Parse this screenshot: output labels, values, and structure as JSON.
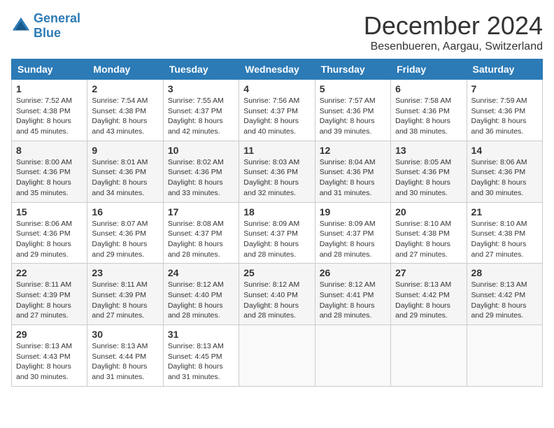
{
  "header": {
    "logo_line1": "General",
    "logo_line2": "Blue",
    "month": "December 2024",
    "location": "Besenbueren, Aargau, Switzerland"
  },
  "weekdays": [
    "Sunday",
    "Monday",
    "Tuesday",
    "Wednesday",
    "Thursday",
    "Friday",
    "Saturday"
  ],
  "weeks": [
    [
      {
        "day": "1",
        "sunrise": "7:52 AM",
        "sunset": "4:38 PM",
        "daylight": "8 hours and 45 minutes."
      },
      {
        "day": "2",
        "sunrise": "7:54 AM",
        "sunset": "4:38 PM",
        "daylight": "8 hours and 43 minutes."
      },
      {
        "day": "3",
        "sunrise": "7:55 AM",
        "sunset": "4:37 PM",
        "daylight": "8 hours and 42 minutes."
      },
      {
        "day": "4",
        "sunrise": "7:56 AM",
        "sunset": "4:37 PM",
        "daylight": "8 hours and 40 minutes."
      },
      {
        "day": "5",
        "sunrise": "7:57 AM",
        "sunset": "4:36 PM",
        "daylight": "8 hours and 39 minutes."
      },
      {
        "day": "6",
        "sunrise": "7:58 AM",
        "sunset": "4:36 PM",
        "daylight": "8 hours and 38 minutes."
      },
      {
        "day": "7",
        "sunrise": "7:59 AM",
        "sunset": "4:36 PM",
        "daylight": "8 hours and 36 minutes."
      }
    ],
    [
      {
        "day": "8",
        "sunrise": "8:00 AM",
        "sunset": "4:36 PM",
        "daylight": "8 hours and 35 minutes."
      },
      {
        "day": "9",
        "sunrise": "8:01 AM",
        "sunset": "4:36 PM",
        "daylight": "8 hours and 34 minutes."
      },
      {
        "day": "10",
        "sunrise": "8:02 AM",
        "sunset": "4:36 PM",
        "daylight": "8 hours and 33 minutes."
      },
      {
        "day": "11",
        "sunrise": "8:03 AM",
        "sunset": "4:36 PM",
        "daylight": "8 hours and 32 minutes."
      },
      {
        "day": "12",
        "sunrise": "8:04 AM",
        "sunset": "4:36 PM",
        "daylight": "8 hours and 31 minutes."
      },
      {
        "day": "13",
        "sunrise": "8:05 AM",
        "sunset": "4:36 PM",
        "daylight": "8 hours and 30 minutes."
      },
      {
        "day": "14",
        "sunrise": "8:06 AM",
        "sunset": "4:36 PM",
        "daylight": "8 hours and 30 minutes."
      }
    ],
    [
      {
        "day": "15",
        "sunrise": "8:06 AM",
        "sunset": "4:36 PM",
        "daylight": "8 hours and 29 minutes."
      },
      {
        "day": "16",
        "sunrise": "8:07 AM",
        "sunset": "4:36 PM",
        "daylight": "8 hours and 29 minutes."
      },
      {
        "day": "17",
        "sunrise": "8:08 AM",
        "sunset": "4:37 PM",
        "daylight": "8 hours and 28 minutes."
      },
      {
        "day": "18",
        "sunrise": "8:09 AM",
        "sunset": "4:37 PM",
        "daylight": "8 hours and 28 minutes."
      },
      {
        "day": "19",
        "sunrise": "8:09 AM",
        "sunset": "4:37 PM",
        "daylight": "8 hours and 28 minutes."
      },
      {
        "day": "20",
        "sunrise": "8:10 AM",
        "sunset": "4:38 PM",
        "daylight": "8 hours and 27 minutes."
      },
      {
        "day": "21",
        "sunrise": "8:10 AM",
        "sunset": "4:38 PM",
        "daylight": "8 hours and 27 minutes."
      }
    ],
    [
      {
        "day": "22",
        "sunrise": "8:11 AM",
        "sunset": "4:39 PM",
        "daylight": "8 hours and 27 minutes."
      },
      {
        "day": "23",
        "sunrise": "8:11 AM",
        "sunset": "4:39 PM",
        "daylight": "8 hours and 27 minutes."
      },
      {
        "day": "24",
        "sunrise": "8:12 AM",
        "sunset": "4:40 PM",
        "daylight": "8 hours and 28 minutes."
      },
      {
        "day": "25",
        "sunrise": "8:12 AM",
        "sunset": "4:40 PM",
        "daylight": "8 hours and 28 minutes."
      },
      {
        "day": "26",
        "sunrise": "8:12 AM",
        "sunset": "4:41 PM",
        "daylight": "8 hours and 28 minutes."
      },
      {
        "day": "27",
        "sunrise": "8:13 AM",
        "sunset": "4:42 PM",
        "daylight": "8 hours and 29 minutes."
      },
      {
        "day": "28",
        "sunrise": "8:13 AM",
        "sunset": "4:42 PM",
        "daylight": "8 hours and 29 minutes."
      }
    ],
    [
      {
        "day": "29",
        "sunrise": "8:13 AM",
        "sunset": "4:43 PM",
        "daylight": "8 hours and 30 minutes."
      },
      {
        "day": "30",
        "sunrise": "8:13 AM",
        "sunset": "4:44 PM",
        "daylight": "8 hours and 31 minutes."
      },
      {
        "day": "31",
        "sunrise": "8:13 AM",
        "sunset": "4:45 PM",
        "daylight": "8 hours and 31 minutes."
      },
      null,
      null,
      null,
      null
    ]
  ]
}
